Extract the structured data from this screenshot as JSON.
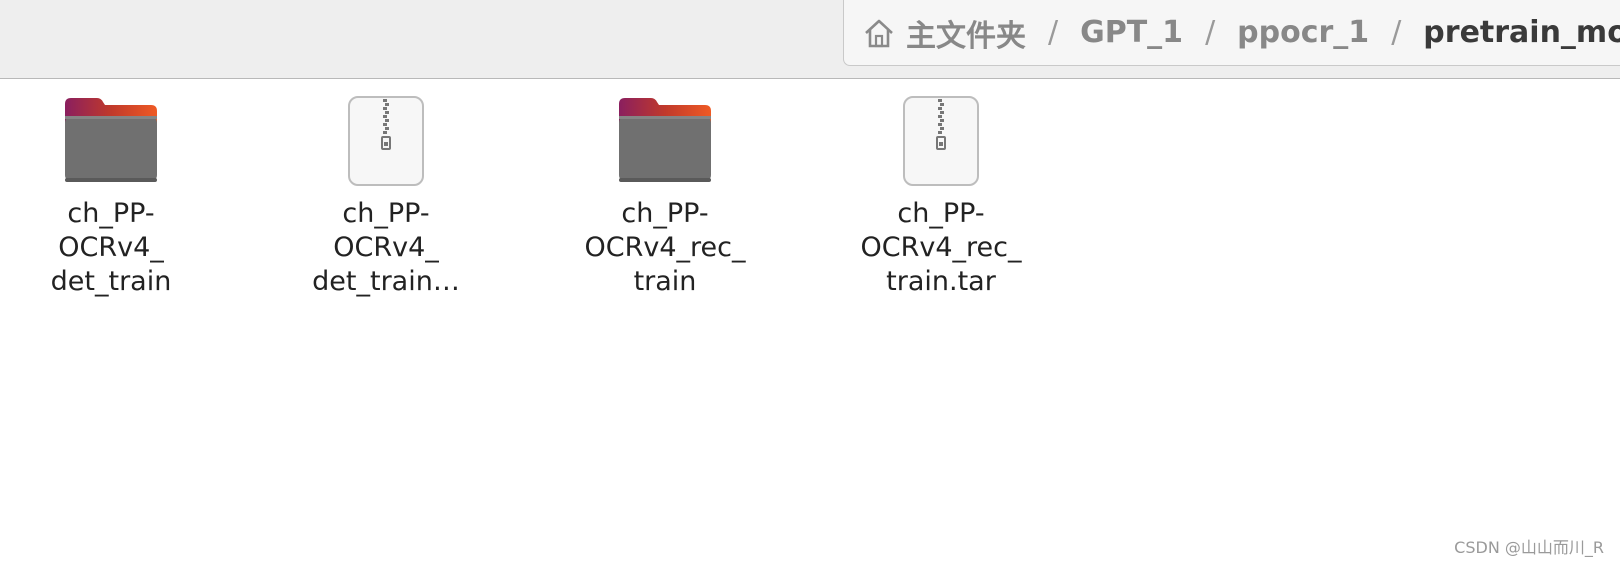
{
  "pathbar": {
    "home": "主文件夹",
    "separator": "/",
    "crumbs": [
      "GPT_1",
      "ppocr_1"
    ],
    "current": "pretrain_models"
  },
  "files": [
    {
      "icon": "folder-icon",
      "lines": [
        "ch_PP-",
        "OCRv4_",
        "det_train"
      ]
    },
    {
      "icon": "archive-icon",
      "lines": [
        "ch_PP-",
        "OCRv4_",
        "det_train…"
      ]
    },
    {
      "icon": "folder-icon",
      "lines": [
        "ch_PP-",
        "OCRv4_rec_",
        "train"
      ]
    },
    {
      "icon": "archive-icon",
      "lines": [
        "ch_PP-",
        "OCRv4_rec_",
        "train.tar"
      ]
    }
  ],
  "watermark": "CSDN @山山而川_R",
  "colors": {
    "folder_body": "#6e6e6e",
    "folder_tab_left": "#8a1f5f",
    "folder_tab_right": "#ef5a24",
    "archive_bg": "#f7f7f7"
  }
}
